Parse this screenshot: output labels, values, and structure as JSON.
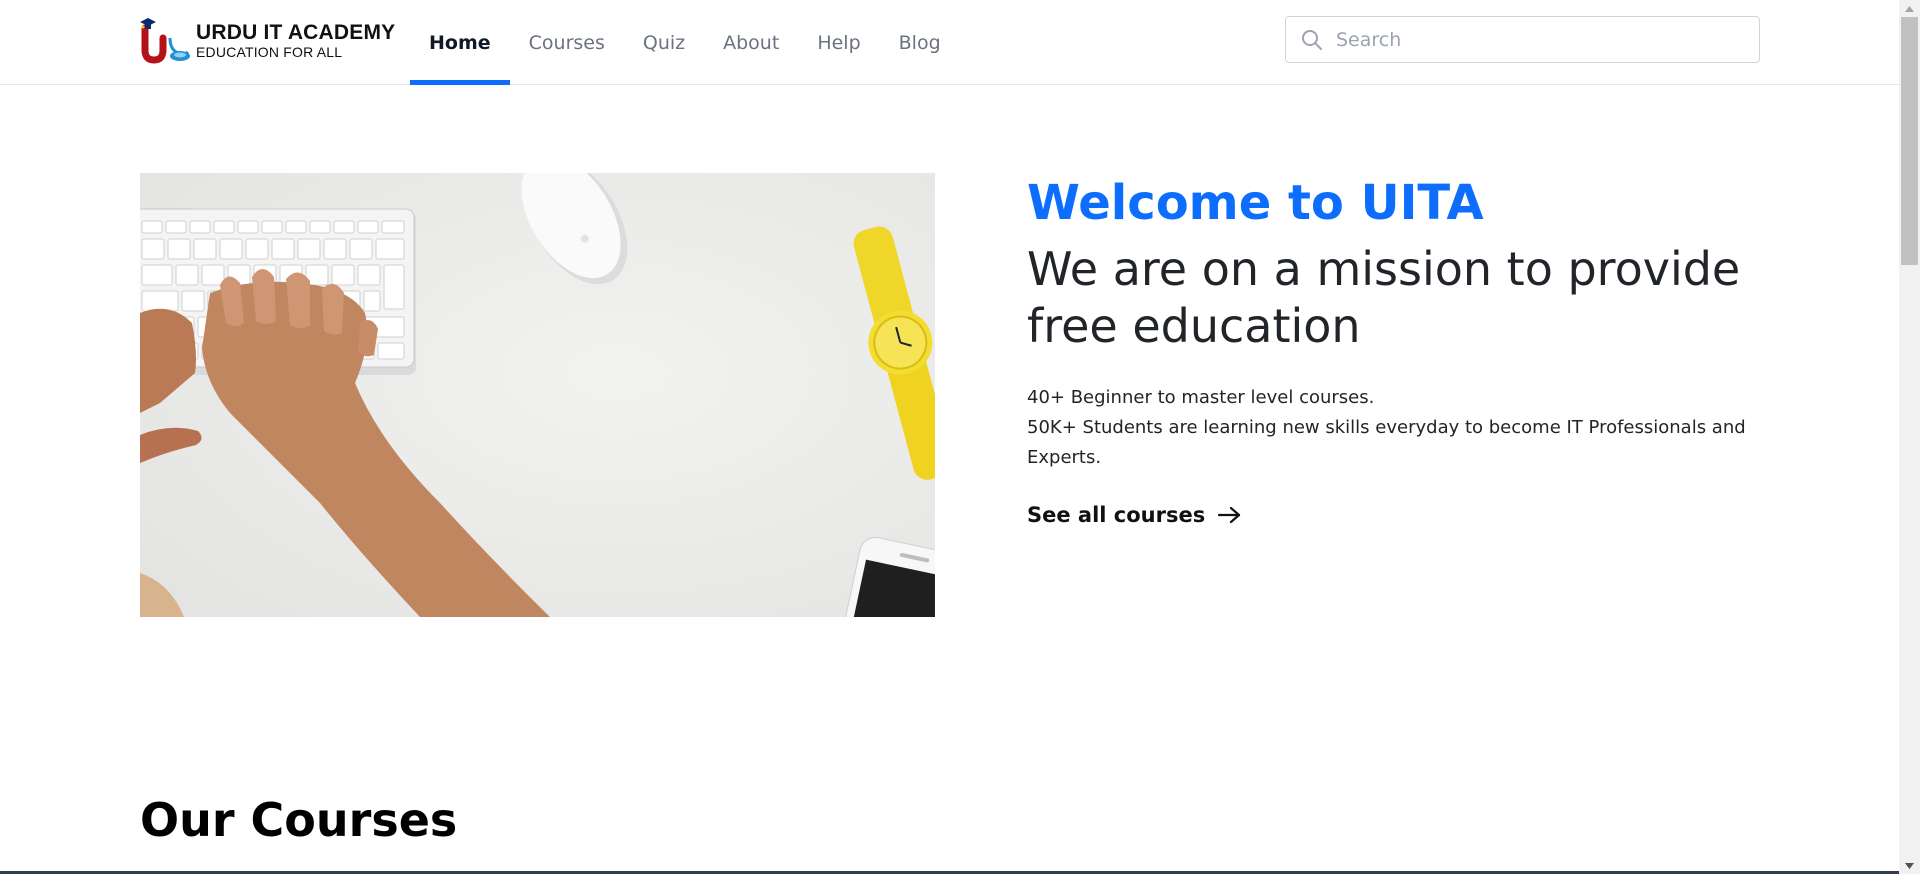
{
  "header": {
    "logo": {
      "title": "URDU IT ACADEMY",
      "subtitle": "EDUCATION FOR ALL"
    },
    "nav": [
      {
        "label": "Home",
        "active": true
      },
      {
        "label": "Courses",
        "active": false
      },
      {
        "label": "Quiz",
        "active": false
      },
      {
        "label": "About",
        "active": false
      },
      {
        "label": "Help",
        "active": false
      },
      {
        "label": "Blog",
        "active": false
      }
    ],
    "search": {
      "placeholder": "Search",
      "value": "",
      "icon": "search-icon"
    }
  },
  "hero": {
    "image": "desk-with-keyboard-hands-mouse-yellow-watch-phone",
    "welcome": "Welcome to UITA",
    "mission": "We are on a mission to provide free education",
    "desc_line1": "40+ Beginner to master level courses.",
    "desc_line2": "50K+ Students are learning new skills everyday to become IT Professionals and Experts.",
    "cta_label": "See all courses",
    "cta_icon": "arrow-right-icon"
  },
  "courses_section": {
    "title": "Our Courses"
  },
  "colors": {
    "accent": "#0d6efd",
    "text": "#212529",
    "nav_inactive": "#6b7280"
  }
}
